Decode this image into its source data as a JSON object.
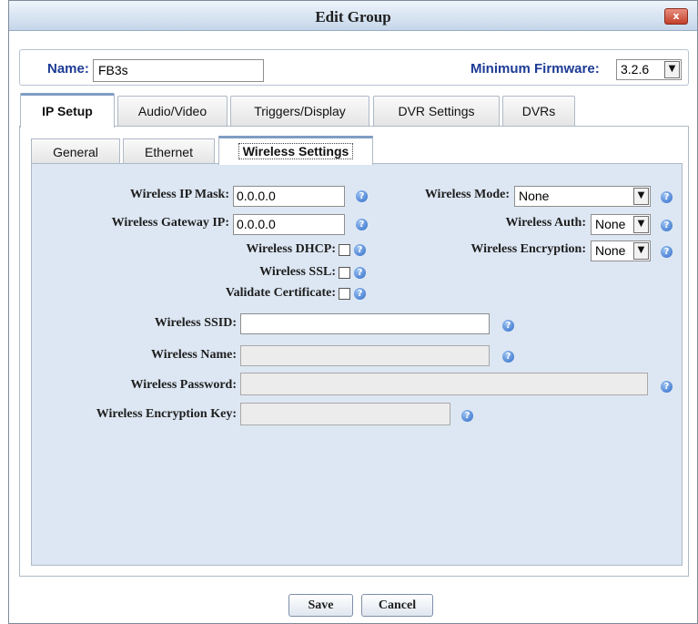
{
  "dialog": {
    "title": "Edit Group",
    "close_symbol": "x"
  },
  "header": {
    "name_label": "Name:",
    "name_value": "FB3s",
    "firmware_label": "Minimum Firmware:",
    "firmware_value": "3.2.6"
  },
  "tabs": [
    "IP Setup",
    "Audio/Video",
    "Triggers/Display",
    "DVR Settings",
    "DVRs"
  ],
  "subtabs": [
    "General",
    "Ethernet",
    "Wireless Settings"
  ],
  "fields": {
    "ip_mask_label": "Wireless IP Mask:",
    "ip_mask_value": "0.0.0.0",
    "gateway_label": "Wireless Gateway IP:",
    "gateway_value": "0.0.0.0",
    "dhcp_label": "Wireless DHCP:",
    "ssl_label": "Wireless SSL:",
    "validate_label": "Validate Certificate:",
    "mode_label": "Wireless Mode:",
    "mode_value": "None",
    "auth_label": "Wireless Auth:",
    "auth_value": "None",
    "encryption_label": "Wireless Encryption:",
    "encryption_value": "None",
    "ssid_label": "Wireless SSID:",
    "ssid_value": "",
    "name_label": "Wireless Name:",
    "name_value": "",
    "password_label": "Wireless Password:",
    "password_value": "",
    "enc_key_label": "Wireless Encryption Key:",
    "enc_key_value": ""
  },
  "help_glyph": "?",
  "dropdown_glyph": "▼",
  "buttons": {
    "save": "Save",
    "cancel": "Cancel"
  },
  "colors": {
    "label_blue": "#1d3b95",
    "panel_bg": "#dde7f3",
    "help_blue": "#2f6cc8"
  }
}
